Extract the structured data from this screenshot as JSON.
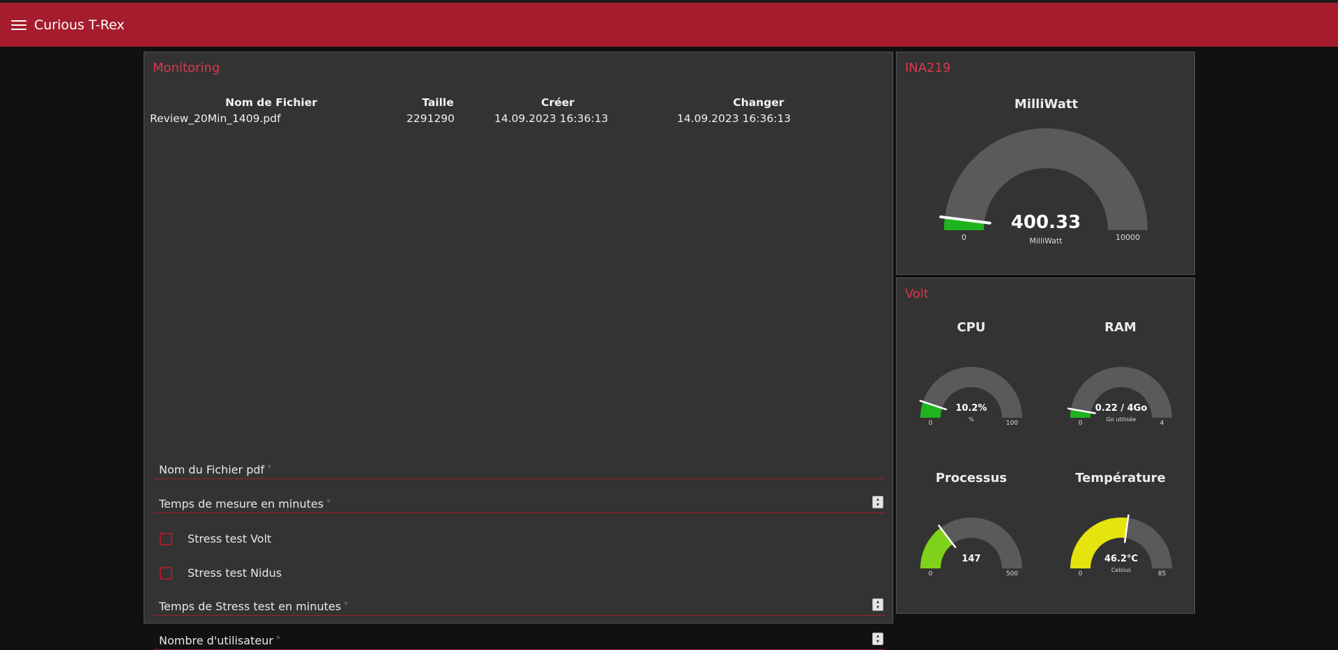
{
  "app": {
    "title": "Curious T-Rex"
  },
  "monitoring": {
    "title": "Monitoring",
    "columns": [
      "Nom de Fichier",
      "Taille",
      "Créer",
      "Changer"
    ],
    "rows": [
      {
        "name": "Review_20Min_1409.pdf",
        "size": "2291290",
        "created": "14.09.2023 16:36:13",
        "changed": "14.09.2023 16:36:13"
      }
    ],
    "form": {
      "pdf_name_label": "Nom du Fichier pdf",
      "measure_time_label": "Temps de mesure en minutes",
      "stress_volt_label": "Stress test Volt",
      "stress_nidus_label": "Stress test Nidus",
      "stress_time_label": "Temps de Stress test en minutes",
      "users_label": "Nombre d'utilisateur",
      "required_mark": "*"
    }
  },
  "ina219": {
    "title": "INA219",
    "gauge": {
      "label": "MilliWatt",
      "value_text": "400.33",
      "value": 400.33,
      "min": 0,
      "max": 10000,
      "min_text": "0",
      "max_text": "10000",
      "unit": "MilliWatt",
      "color": "#1fb41f"
    }
  },
  "volt": {
    "title": "Volt",
    "gauges": [
      {
        "label": "CPU",
        "value_text": "10.2%",
        "value": 10.2,
        "min": 0,
        "max": 100,
        "min_text": "0",
        "max_text": "100",
        "unit": "%",
        "color": "#1fb41f"
      },
      {
        "label": "RAM",
        "value_text": "0.22 / 4Go",
        "value": 0.22,
        "min": 0,
        "max": 4,
        "min_text": "0",
        "max_text": "4",
        "unit": "Go utilisée",
        "color": "#1fb41f"
      },
      {
        "label": "Processus",
        "value_text": "147",
        "value": 147,
        "min": 0,
        "max": 500,
        "min_text": "0",
        "max_text": "500",
        "unit": "",
        "color": "#7fd21a"
      },
      {
        "label": "Température",
        "value_text": "46.2°C",
        "value": 46.2,
        "min": 0,
        "max": 85,
        "min_text": "0",
        "max_text": "85",
        "unit": "Celsius",
        "color": "#e4e40e"
      }
    ]
  },
  "colors": {
    "accent": "#a51c2c",
    "link": "#d8394a",
    "panel": "#333333",
    "gauge_track": "#5a5a5a"
  }
}
